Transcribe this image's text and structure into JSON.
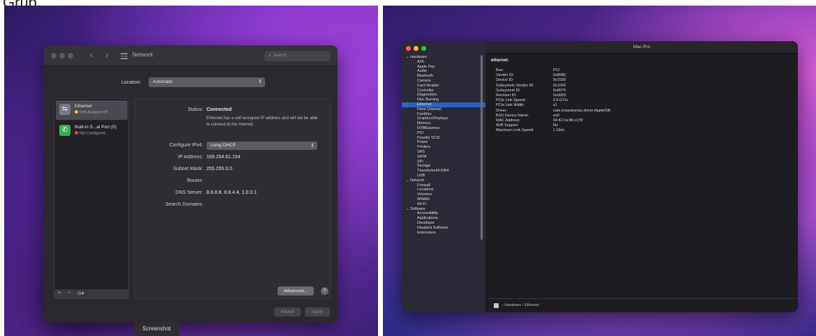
{
  "corner_text": "Grub",
  "network_window": {
    "title": "Network",
    "search_placeholder": "Search",
    "location_label": "Location:",
    "location_value": "Automatic",
    "services": [
      {
        "name": "Ethernet",
        "status": "Self-Assigned IP",
        "status_color": "#e8c23a",
        "icon": "ethernet-icon"
      },
      {
        "name": "Built-in S...al Port (0)",
        "status": "Not Configured",
        "status_color": "#e04a3a",
        "icon": "phone-icon"
      }
    ],
    "list_buttons": [
      "+",
      "−",
      "⊙▾"
    ],
    "status_label": "Status:",
    "status_value": "Connected",
    "status_note": "Ethernet has a self-assigned IP address and will not be able to connect to the Internet.",
    "configure_label": "Configure IPv4:",
    "configure_value": "Using DHCP",
    "ip_label": "IP Address:",
    "ip_value": "169.254.61.154",
    "subnet_label": "Subnet Mask:",
    "subnet_value": "255.255.0.0",
    "router_label": "Router:",
    "router_value": "",
    "dns_label": "DNS Server:",
    "dns_value": "8.8.8.8, 8.8.4.4, 1.0.0.1",
    "search_domains_label": "Search Domains:",
    "advanced_label": "Advanced...",
    "help_label": "?",
    "revert_label": "Revert",
    "apply_label": "Apply",
    "screenshot_tag": "Screenshot"
  },
  "system_info": {
    "title": "Mac Pro",
    "tree": [
      {
        "label": "Hardware",
        "level": 0,
        "expanded": true
      },
      {
        "label": "ATA",
        "level": 1
      },
      {
        "label": "Apple Pay",
        "level": 1
      },
      {
        "label": "Audio",
        "level": 1
      },
      {
        "label": "Bluetooth",
        "level": 1
      },
      {
        "label": "Camera",
        "level": 1
      },
      {
        "label": "Card Reader",
        "level": 1
      },
      {
        "label": "Controller",
        "level": 1
      },
      {
        "label": "Diagnostics",
        "level": 1
      },
      {
        "label": "Disc Burning",
        "level": 1
      },
      {
        "label": "Ethernet",
        "level": 1,
        "selected": true
      },
      {
        "label": "Fibre Channel",
        "level": 1
      },
      {
        "label": "FireWire",
        "level": 1
      },
      {
        "label": "Graphics/Displays",
        "level": 1
      },
      {
        "label": "Memory",
        "level": 1
      },
      {
        "label": "NVMExpress",
        "level": 1
      },
      {
        "label": "PCI",
        "level": 1
      },
      {
        "label": "Parallel SCSI",
        "level": 1
      },
      {
        "label": "Power",
        "level": 1
      },
      {
        "label": "Printers",
        "level": 1
      },
      {
        "label": "SAS",
        "level": 1
      },
      {
        "label": "SATA",
        "level": 1
      },
      {
        "label": "SPI",
        "level": 1
      },
      {
        "label": "Storage",
        "level": 1
      },
      {
        "label": "Thunderbolt/USB4",
        "level": 1
      },
      {
        "label": "USB",
        "level": 1
      },
      {
        "label": "Network",
        "level": 0,
        "expanded": true
      },
      {
        "label": "Firewall",
        "level": 1
      },
      {
        "label": "Locations",
        "level": 1
      },
      {
        "label": "Volumes",
        "level": 1
      },
      {
        "label": "WWAN",
        "level": 1
      },
      {
        "label": "Wi-Fi",
        "level": 1
      },
      {
        "label": "Software",
        "level": 0,
        "expanded": true
      },
      {
        "label": "Accessibility",
        "level": 1
      },
      {
        "label": "Applications",
        "level": 1
      },
      {
        "label": "Developer",
        "level": 1
      },
      {
        "label": "Disabled Software",
        "level": 1
      },
      {
        "label": "Extensions",
        "level": 1
      }
    ],
    "heading": "ethernet:",
    "details": [
      {
        "key": "Bus:",
        "value": "PCI"
      },
      {
        "key": "Vendor ID:",
        "value": "0x8086"
      },
      {
        "key": "Device ID:",
        "value": "0x1539"
      },
      {
        "key": "Subsystem Vendor ID:",
        "value": "0x1043"
      },
      {
        "key": "Subsystem ID:",
        "value": "0x8670"
      },
      {
        "key": "Revision ID:",
        "value": "0x0003"
      },
      {
        "key": "PCIe Link Speed:",
        "value": "2.5 GT/s"
      },
      {
        "key": "PCIe Link Width:",
        "value": "x1"
      },
      {
        "key": "Driver:",
        "value": "com.insanelymac.driver.AppleIGB"
      },
      {
        "key": "BSD Device Name:",
        "value": "en0"
      },
      {
        "key": "MAC Address:",
        "value": "04:42:1a:8b:c1:5f"
      },
      {
        "key": "AVB Support:",
        "value": "No"
      },
      {
        "key": "Maximum Link Speed:",
        "value": "1 Gb/s"
      }
    ],
    "footer_path": "› Hardware › Ethernet"
  }
}
